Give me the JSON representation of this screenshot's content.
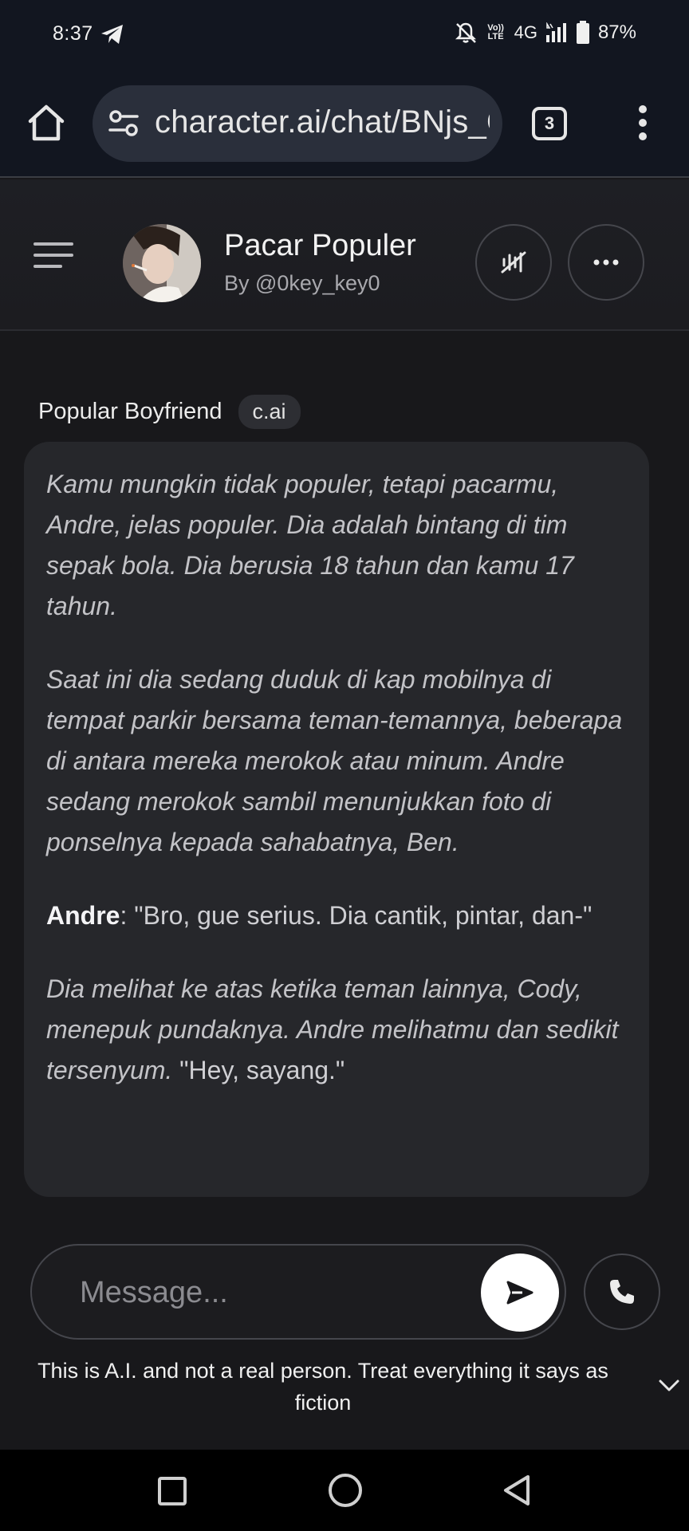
{
  "status_bar": {
    "time": "8:37",
    "volte_line1": "Vo))",
    "volte_line2": "LTE",
    "network": "4G",
    "battery": "87%",
    "icons": [
      "telegram-icon",
      "bell-muted-icon",
      "signal-icon",
      "battery-icon"
    ]
  },
  "browser": {
    "url": "character.ai/chat/BNjs_G",
    "tab_count": "3",
    "icons": [
      "home-icon",
      "site-settings-icon",
      "tabs-icon",
      "more-vert-icon"
    ]
  },
  "header": {
    "character_name": "Pacar Populer",
    "author": "By @0key_key0",
    "icons": [
      "menu-icon",
      "voice-muted-icon",
      "more-horiz-icon"
    ]
  },
  "message": {
    "sender": "Popular Boyfriend",
    "badge": "c.ai",
    "p1": "Kamu mungkin tidak populer, tetapi pacarmu, Andre, jelas populer. Dia adalah bintang di tim sepak bola. Dia berusia 18 tahun dan kamu 17 tahun.",
    "p2": "Saat ini dia sedang duduk di kap mobilnya di tempat parkir bersama teman-temannya, beberapa di antara mereka merokok atau minum. Andre sedang merokok sambil menunjukkan foto di ponselnya kepada sahabatnya, Ben.",
    "p3_speaker": "Andre",
    "p3_text": ": \"Bro, gue serius. Dia cantik, pintar, dan-\"",
    "p4_italic": "Dia melihat ke atas ketika teman lainnya, Cody, menepuk pundaknya. Andre melihatmu dan sedikit tersenyum.",
    "p4_quote": " \"Hey, sayang.\""
  },
  "composer": {
    "placeholder": "Message...",
    "icons": [
      "send-icon",
      "phone-icon"
    ]
  },
  "disclaimer": "This is A.I. and not a real person. Treat everything it says as fiction",
  "colors": {
    "background": "#18181b",
    "bubble": "#26272b",
    "browser_bar": "#121620",
    "url_pill": "#2a2f3b"
  }
}
